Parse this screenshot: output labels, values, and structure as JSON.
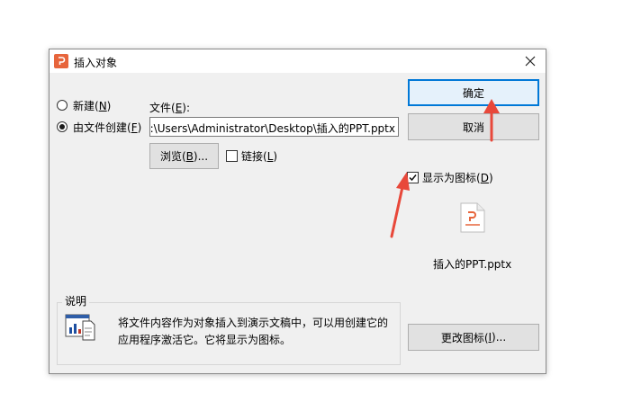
{
  "dialog": {
    "title": "插入对象",
    "icons": {
      "app": "presentation-app-icon",
      "close": "close-icon"
    }
  },
  "options": {
    "new": {
      "label": "新建(",
      "key": "N",
      "suffix": ")",
      "selected": false
    },
    "from_file": {
      "label": "由文件创建(",
      "key": "F",
      "suffix": ")",
      "selected": true
    }
  },
  "file": {
    "label": "文件(",
    "key": "E",
    "suffix": "):",
    "path": ":\\Users\\Administrator\\Desktop\\插入的PPT.pptx"
  },
  "browse": {
    "label": "浏览(",
    "key": "B",
    "suffix": ")..."
  },
  "link": {
    "label": "链接(",
    "key": "L",
    "suffix": ")",
    "checked": false
  },
  "buttons": {
    "ok": "确定",
    "cancel": "取消",
    "change_icon": {
      "label": "更改图标(",
      "key": "I",
      "suffix": ")..."
    }
  },
  "display_as_icon": {
    "label": "显示为图标(",
    "key": "D",
    "suffix": ")",
    "checked": true
  },
  "preview": {
    "filename": "插入的PPT.pptx",
    "icon": "pptx-file-icon"
  },
  "description": {
    "group_label": "说明",
    "text": "将文件内容作为对象插入到演示文稿中，可以用创建它的应用程序激活它。它将显示为图标。",
    "icon": "embedded-object-icon"
  },
  "colors": {
    "annotation_arrow": "#e8483a",
    "accent": "#0078d7",
    "ppt_orange": "#e7653c"
  }
}
